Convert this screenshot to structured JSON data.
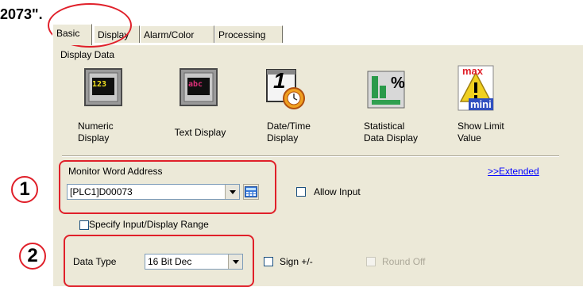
{
  "prefix_fragment": "2073\".",
  "tabs": [
    {
      "label": "Basic"
    },
    {
      "label": "Display"
    },
    {
      "label": "Alarm/Color"
    },
    {
      "label": "Processing"
    }
  ],
  "group_title": "Display Data",
  "display_types": [
    {
      "line1": "Numeric",
      "line2": "Display",
      "icon": "numeric-display-icon",
      "glyph": "123"
    },
    {
      "line1": "Text Display",
      "line2": "",
      "icon": "text-display-icon",
      "glyph": "abc"
    },
    {
      "line1": "Date/Time",
      "line2": "Display",
      "icon": "datetime-display-icon",
      "glyph": "1"
    },
    {
      "line1": "Statistical",
      "line2": "Data Display",
      "icon": "statistical-display-icon",
      "glyph": "%"
    },
    {
      "line1": "Show Limit",
      "line2": "Value",
      "icon": "limit-value-icon",
      "glyph_top": "max",
      "glyph_bottom": "mini"
    }
  ],
  "monitor": {
    "label": "Monitor Word Address",
    "value": "[PLC1]D00073",
    "extended_link": ">>Extended",
    "allow_input": "Allow Input"
  },
  "range_checkbox": "Specify Input/Display Range",
  "data_type": {
    "label": "Data Type",
    "value": "16 Bit Dec",
    "sign": "Sign +/-",
    "round_off": "Round Off"
  },
  "callouts": {
    "one": "1",
    "two": "2"
  },
  "colors": {
    "callout_red": "#e0202a",
    "panel": "#ece9d8",
    "link": "#0000ff"
  }
}
